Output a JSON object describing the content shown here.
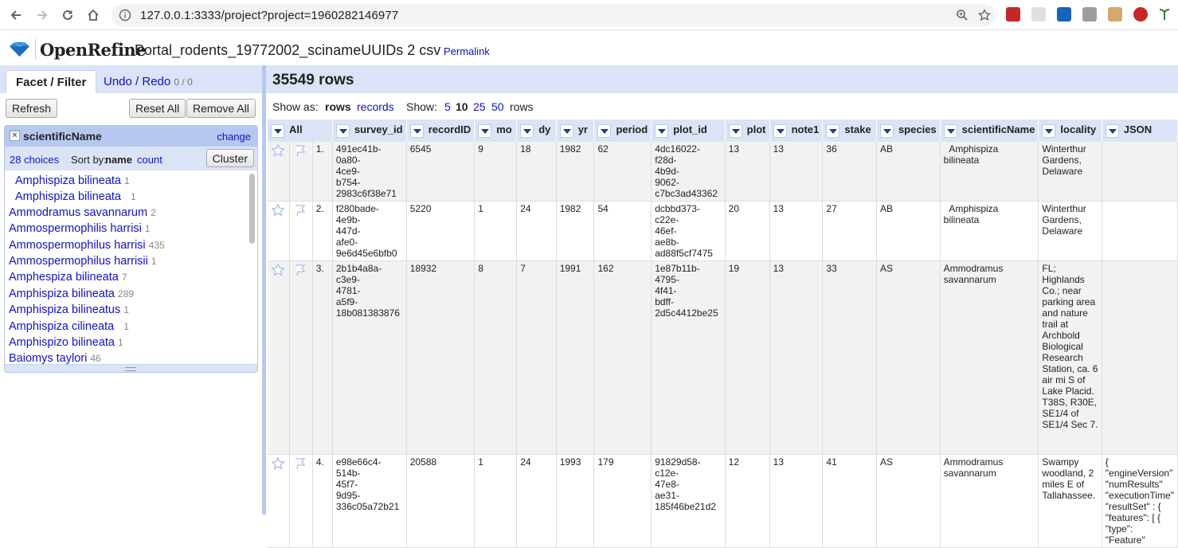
{
  "browser": {
    "url": "127.0.0.1:3333/project?project=1960282146977"
  },
  "app": {
    "name": "OpenRefine",
    "project_name": "Portal_rodents_19772002_scinameUUIDs 2 csv",
    "permalink": "Permalink"
  },
  "left": {
    "tab_facet": "Facet / Filter",
    "tab_undo": "Undo / Redo",
    "undo_count": "0 / 0",
    "refresh": "Refresh",
    "reset_all": "Reset All",
    "remove_all": "Remove All",
    "facet": {
      "name": "scientificName",
      "change": "change",
      "choices": "28 choices",
      "sort_by": "Sort by:",
      "sort_name": "name",
      "sort_count": "count",
      "cluster": "Cluster",
      "items": [
        {
          "label": "  Amphispiza bilineata",
          "count": "1"
        },
        {
          "label": "  Amphispiza bilineata ",
          "count": "1"
        },
        {
          "label": "Ammodramus savannarum",
          "count": "2"
        },
        {
          "label": "Ammospermophilis harrisi",
          "count": "1"
        },
        {
          "label": "Ammospermophilus harrisi",
          "count": "435"
        },
        {
          "label": "Ammospermophilus harrisii",
          "count": "1"
        },
        {
          "label": "Amphespiza bilineata",
          "count": "7"
        },
        {
          "label": "Amphispiza bilineata",
          "count": "289"
        },
        {
          "label": "Amphispiza bilineatus",
          "count": "1"
        },
        {
          "label": "Amphispiza cilineata ",
          "count": "1"
        },
        {
          "label": "Amphispizo bilineata",
          "count": "1"
        },
        {
          "label": "Baiomys taylori",
          "count": "46"
        }
      ]
    }
  },
  "right": {
    "row_count": "35549 rows",
    "show_as": "Show as:",
    "rows": "rows",
    "records": "records",
    "show": "Show:",
    "opt5": "5",
    "opt10": "10",
    "opt25": "25",
    "opt50": "50",
    "rows_suffix": "rows",
    "columns": [
      "All",
      "survey_id",
      "recordID",
      "mo",
      "dy",
      "yr",
      "period",
      "plot_id",
      "plot",
      "note1",
      "stake",
      "species",
      "scientificName",
      "locality",
      "JSON"
    ],
    "data": [
      {
        "idx": "1.",
        "survey_id": "491ec41b-0a80-4ce9-b754-2983c6f38e71",
        "recordID": "6545",
        "mo": "9",
        "dy": "18",
        "yr": "1982",
        "period": "62",
        "plot_id": "4dc16022-f28d-4b9d-9062-c7bc3ad43362",
        "plot": "13",
        "note1": "13",
        "stake": "36",
        "species": "AB",
        "scientificName": "  Amphispiza bilineata",
        "locality": "Winterthur Gardens, Delaware",
        "json": ""
      },
      {
        "idx": "2.",
        "survey_id": "f280bade-4e9b-447d-afe0-9e6d45e6bfb0",
        "recordID": "5220",
        "mo": "1",
        "dy": "24",
        "yr": "1982",
        "period": "54",
        "plot_id": "dcbbd373-c22e-46ef-ae8b-ad88f5cf7475",
        "plot": "20",
        "note1": "13",
        "stake": "27",
        "species": "AB",
        "scientificName": "  Amphispiza bilineata",
        "locality": "Winterthur Gardens, Delaware",
        "json": ""
      },
      {
        "idx": "3.",
        "survey_id": "2b1b4a8a-c3e9-4781-a5f9-18b081383876",
        "recordID": "18932",
        "mo": "8",
        "dy": "7",
        "yr": "1991",
        "period": "162",
        "plot_id": "1e87b11b-4795-4f41-bdff-2d5c4412be25",
        "plot": "19",
        "note1": "13",
        "stake": "33",
        "species": "AS",
        "scientificName": "Ammodramus savannarum",
        "locality": "FL; Highlands Co.; near parking area and nature trail at Archbold Biological Research Station, ca. 6 air mi S of Lake Placid. T38S, R30E, SE1/4 of SE1/4 Sec 7.",
        "json": ""
      },
      {
        "idx": "4.",
        "survey_id": "e98e66c4-514b-45f7-9d95-336c05a72b21",
        "recordID": "20588",
        "mo": "1",
        "dy": "24",
        "yr": "1993",
        "period": "179",
        "plot_id": "91829d58-c12e-47e8-ae31-185f46be21d2",
        "plot": "12",
        "note1": "13",
        "stake": "41",
        "species": "AS",
        "scientificName": "Ammodramus savannarum",
        "locality": "Swampy woodland, 2 miles E of Tallahassee.",
        "json": "{ \"engineVersion\" \"numResults\" \"executionTime\" \"resultSet\" : { \"features\": [ { \"type\": \"Feature\""
      }
    ]
  }
}
